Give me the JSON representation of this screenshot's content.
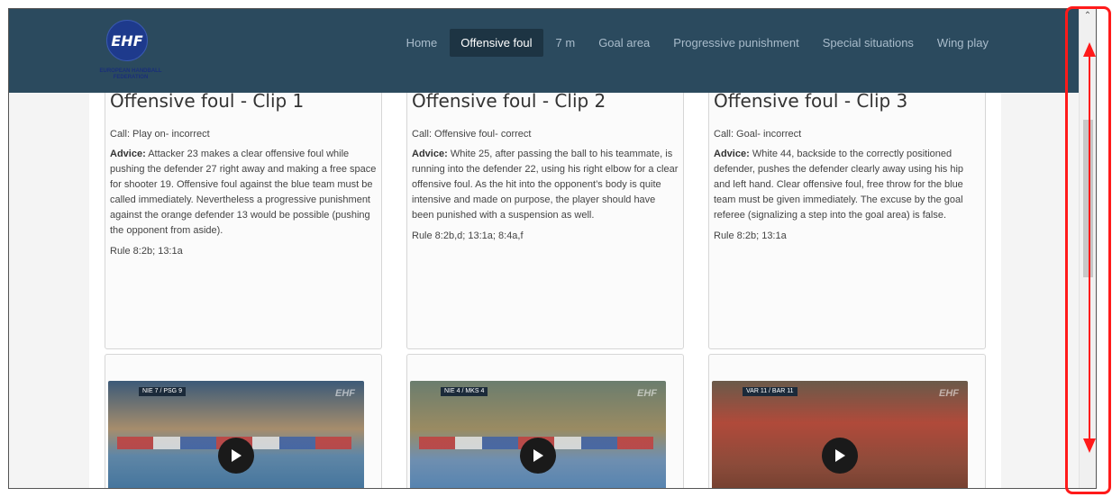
{
  "logo": {
    "text": "EHF",
    "subtitle": "EUROPEAN HANDBALL FEDERATION"
  },
  "nav": {
    "items": [
      {
        "label": "Home"
      },
      {
        "label": "Offensive foul",
        "active": true
      },
      {
        "label": "7 m"
      },
      {
        "label": "Goal area"
      },
      {
        "label": "Progressive punishment"
      },
      {
        "label": "Special situations"
      },
      {
        "label": "Wing play"
      }
    ]
  },
  "clips": [
    {
      "title": "Offensive foul - Clip 1",
      "call": "Call: Play on- incorrect",
      "advice_label": "Advice:",
      "advice": "Attacker 23 makes a clear offensive foul while pushing the defender 27 right away and making a free space for shooter 19. Offensive foul against the blue team must be called immediately. Nevertheless a progressive punishment against the orange defender 13 would be possible (pushing the opponent from aside).",
      "rule": "Rule 8:2b; 13:1a",
      "score": "NIE 7 / PSG 9"
    },
    {
      "title": "Offensive foul - Clip 2",
      "call": "Call: Offensive foul- correct",
      "advice_label": "Advice:",
      "advice": "White 25, after passing the ball to his teammate, is running into the defender 22, using his right elbow for a clear offensive foul. As the hit into the opponent’s body is quite intensive and made on purpose, the player should have been punished with a suspension as well.",
      "rule": "Rule 8:2b,d; 13:1a; 8:4a,f",
      "score": "NIE 4 / MKS 4"
    },
    {
      "title": "Offensive foul - Clip 3",
      "call": "Call: Goal- incorrect",
      "advice_label": "Advice:",
      "advice": "White 44, backside to the correctly positioned defender, pushes the defender clearly away using his hip and left hand. Clear offensive foul, free throw for the blue team must be given immediately. The excuse by the goal referee (signalizing a step into the goal area) is false.",
      "rule": "Rule 8:2b; 13:1a",
      "score": "VAR 11 / BAR 11"
    }
  ],
  "video": {
    "watermark": "EHF"
  },
  "colors": {
    "header": "#2b4a5e",
    "nav_active": "#1d3443",
    "annotation": "#ff1a1a"
  }
}
